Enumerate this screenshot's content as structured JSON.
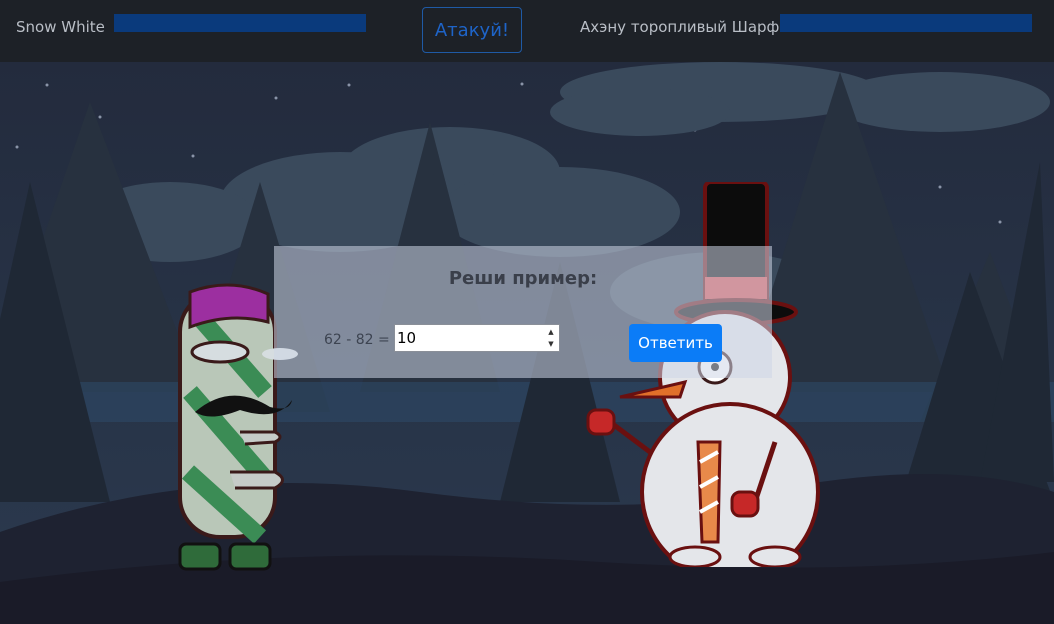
{
  "header": {
    "player_name": "Snow White",
    "attack_label": "Атакуй!",
    "enemy_name": "Ахэну торопливый Шарф",
    "player_health": 1.0,
    "enemy_health": 1.0
  },
  "dialog": {
    "title": "Реши пример:",
    "expression": "62 - 82 =",
    "answer_value": "10",
    "submit_label": "Ответить"
  },
  "colors": {
    "topbar": "#1d2127",
    "health_bar": "#0a3a7c",
    "submit_button": "#0b7cf7",
    "attack_button_text": "#1e64c8"
  },
  "icons": {
    "spinner_up": "▲",
    "spinner_down": "▼"
  }
}
